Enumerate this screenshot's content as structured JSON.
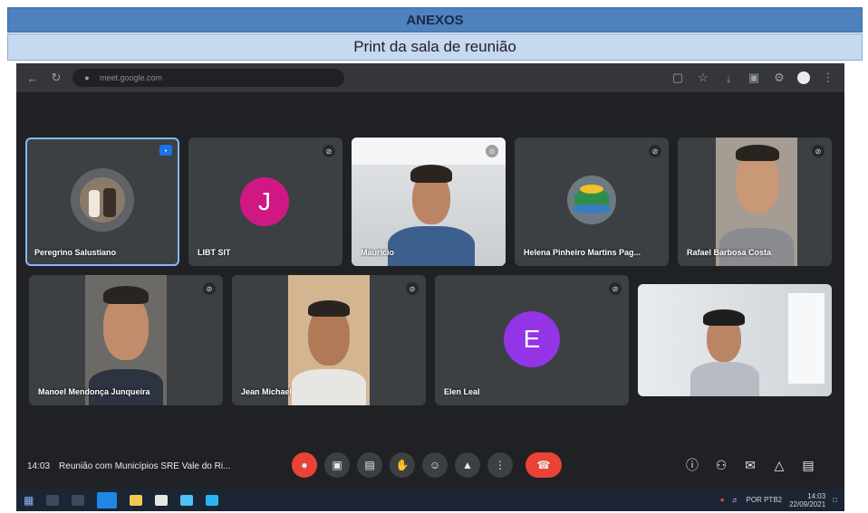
{
  "document": {
    "section_title": "ANEXOS",
    "subtitle": "Print da sala de reunião"
  },
  "browser": {
    "url": "meet.google.com"
  },
  "participants": [
    {
      "name": "Peregrino Salustiano",
      "type": "avatar-photo"
    },
    {
      "name": "LIBT SIT",
      "initial": "J",
      "avatar_color": "#d01884"
    },
    {
      "name": "Maurício",
      "type": "video"
    },
    {
      "name": "Helena Pinheiro Martins Pag...",
      "type": "avatar-logo"
    },
    {
      "name": "Rafael Barbosa Costa",
      "type": "video"
    },
    {
      "name": "Manoel Mendonça Junqueira",
      "type": "video"
    },
    {
      "name": "Jean Michael",
      "type": "video"
    },
    {
      "name": "Elen Leal",
      "initial": "E",
      "avatar_color": "#9334e6"
    },
    {
      "name": "",
      "type": "video"
    }
  ],
  "meeting": {
    "time": "14:03",
    "title": "Reunião com Municípios SRE Vale do Ri..."
  },
  "taskbar": {
    "time": "14:03",
    "date": "22/09/2021",
    "lang": "POR PTB2"
  },
  "colors": {
    "header_blue": "#4f81bd",
    "subheader_blue": "#c6d9f1",
    "hangup_red": "#ea4335",
    "meet_bg": "#202124",
    "tile_bg": "#3c4043"
  },
  "icons": [
    "back-arrow-icon",
    "reload-icon",
    "lock-icon",
    "microphone-icon",
    "camera-icon",
    "captions-icon",
    "raise-hand-icon",
    "present-icon",
    "more-options-icon",
    "hang-up-icon",
    "info-icon",
    "people-icon",
    "chat-icon",
    "activities-icon",
    "lock-meeting-icon",
    "windows-start-icon"
  ]
}
